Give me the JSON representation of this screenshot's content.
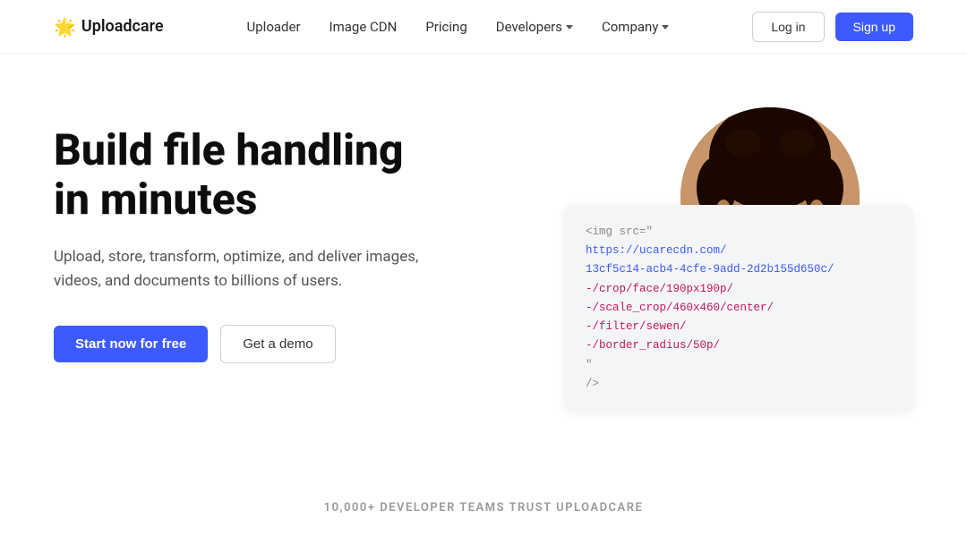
{
  "brand": {
    "name": "Uploadcare",
    "logo_icon": "🌟"
  },
  "nav": {
    "links": [
      {
        "label": "Uploader",
        "has_dropdown": false
      },
      {
        "label": "Image CDN",
        "has_dropdown": false
      },
      {
        "label": "Pricing",
        "has_dropdown": false
      },
      {
        "label": "Developers",
        "has_dropdown": true
      },
      {
        "label": "Company",
        "has_dropdown": true
      }
    ],
    "login_label": "Log in",
    "signup_label": "Sign up"
  },
  "hero": {
    "title_line1": "Build file handling",
    "title_line2": "in minutes",
    "subtitle": "Upload, store, transform, optimize, and deliver images, videos, and documents to billions of users.",
    "cta_primary": "Start now for free",
    "cta_secondary": "Get a demo"
  },
  "code_block": {
    "tag_open": "<img src=\"",
    "url_line1": "https://ucarecdn.com/",
    "url_line2": "13cf5c14-acb4-4cfe-9add-2d2b155d650c/",
    "transform1": "-/crop/face/190px190p/",
    "transform2": "-/scale_crop/460x460/center/",
    "transform3": "-/filter/sewen/",
    "transform4": "-/border_radius/50p/",
    "attr_line": "\"",
    "tag_close": "/>"
  },
  "trust": {
    "text": "10,000+ DEVELOPER TEAMS TRUST UPLOADCARE"
  }
}
